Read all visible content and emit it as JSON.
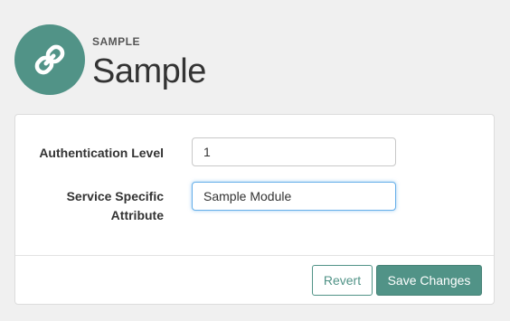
{
  "header": {
    "icon": "link-icon",
    "icon_color": "#519387",
    "kicker": "SAMPLE",
    "title": "Sample"
  },
  "form": {
    "auth_level": {
      "label": "Authentication Level",
      "value": "1"
    },
    "service_attr": {
      "label_line1": "Service Specific",
      "label_line2": "Attribute",
      "value": "Sample Module"
    }
  },
  "actions": {
    "revert_label": "Revert",
    "save_label": "Save Changes",
    "accent": "#519387"
  }
}
